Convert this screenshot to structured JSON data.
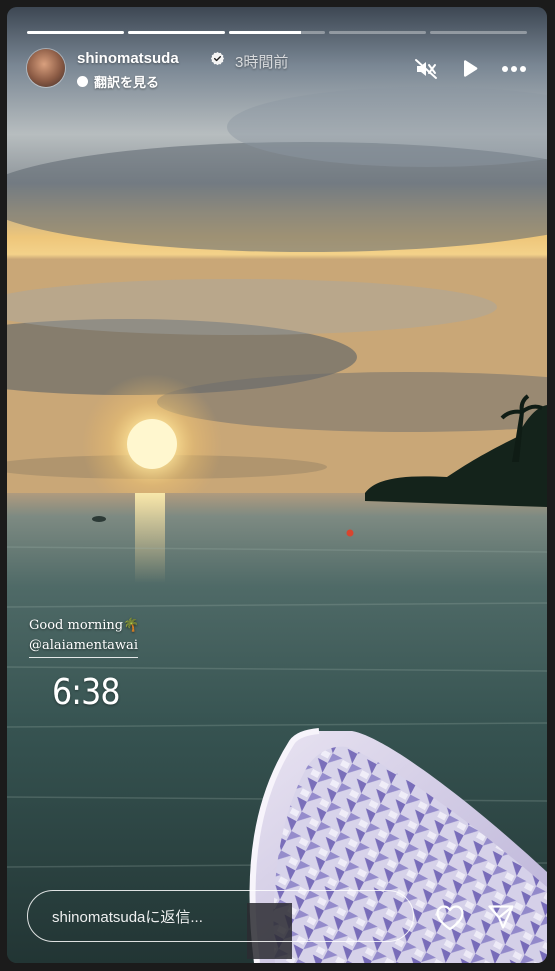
{
  "story": {
    "username": "shinomatsuda",
    "verified": true,
    "time_ago": "3時間前",
    "translate_label": "翻訳を見る",
    "segments": [
      1.0,
      1.0,
      0.75,
      0.0,
      0.0
    ],
    "caption_line1": "Good morning🌴",
    "caption_mention": "@alaiamentawai",
    "clock_sticker": "6:38"
  },
  "reply": {
    "placeholder": "shinomatsudaに返信..."
  },
  "icons": {
    "mute": "speaker-muted-icon",
    "play": "play-icon",
    "more": "more-horizontal-icon",
    "like": "heart-icon",
    "share": "send-icon",
    "verified": "verified-badge-icon"
  },
  "colors": {
    "sky_top": "#46525e",
    "sun": "#fff2b8",
    "water": "#2f4b4a"
  }
}
